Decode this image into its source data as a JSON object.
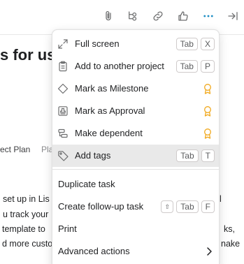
{
  "toolbar": {
    "icons": [
      "paperclip-icon",
      "subtask-icon",
      "link-icon",
      "thumbs-up-icon",
      "more-icon",
      "close-pane-icon"
    ],
    "active_color": "#1e8ec4"
  },
  "background": {
    "title": "s for us",
    "tabs": [
      "ect Plan",
      "Pla"
    ],
    "lines": [
      "set up in Lis",
      "u track your",
      "template to",
      "d more custo"
    ],
    "right_fragments": [
      "l",
      "ks,",
      "nake"
    ]
  },
  "menu": {
    "items": [
      {
        "label": "Full screen",
        "icon": "expand-icon",
        "keys": [
          "Tab",
          "X"
        ]
      },
      {
        "label": "Add to another project",
        "icon": "clipboard-icon",
        "keys": [
          "Tab",
          "P"
        ]
      },
      {
        "label": "Mark as Milestone",
        "icon": "diamond-icon",
        "premium": true
      },
      {
        "label": "Mark as Approval",
        "icon": "approval-stamp-icon",
        "premium": true
      },
      {
        "label": "Make dependent",
        "icon": "dependency-icon",
        "premium": true
      },
      {
        "label": "Add tags",
        "icon": "tag-icon",
        "keys": [
          "Tab",
          "T"
        ],
        "highlighted": true
      },
      {
        "label": "Duplicate task"
      },
      {
        "label": "Create follow-up task",
        "keys": [
          "⇧",
          "Tab",
          "F"
        ]
      },
      {
        "label": "Print"
      },
      {
        "label": "Advanced actions",
        "submenu": true
      }
    ],
    "premium_color": "#f1a81c",
    "highlight_color": "#e9e9e9"
  }
}
